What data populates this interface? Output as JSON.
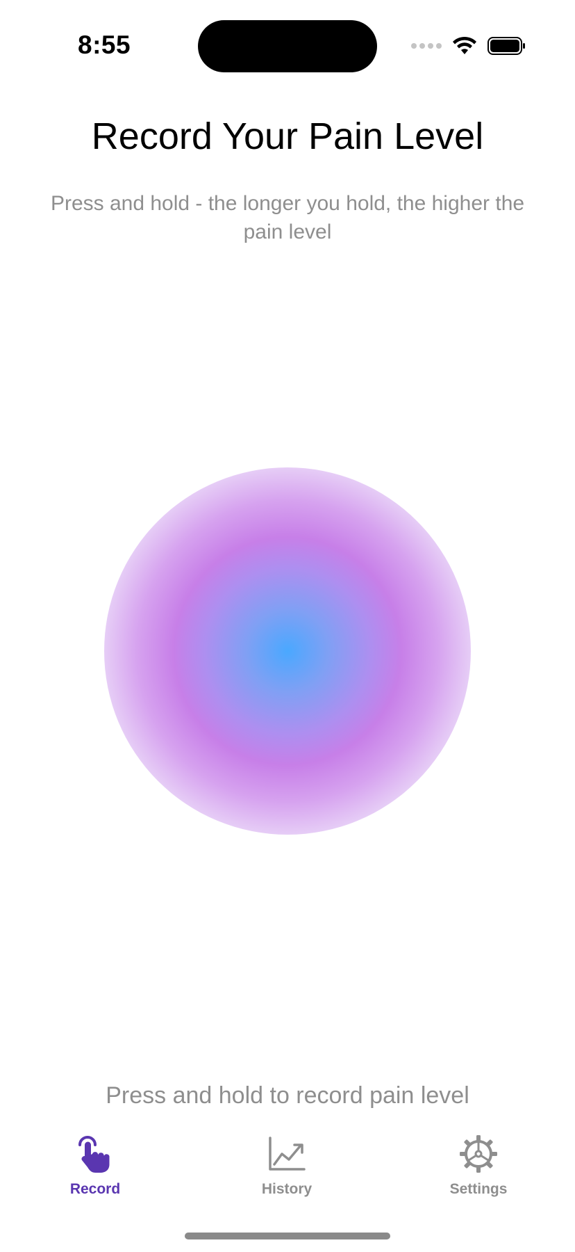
{
  "status_bar": {
    "time": "8:55"
  },
  "header": {
    "title": "Record Your Pain Level",
    "subtitle": "Press and hold - the longer you hold, the higher the pain level"
  },
  "hint": "Press and hold to record pain level",
  "colors": {
    "accent": "#5a36b0",
    "inactive": "#8e8e8e",
    "circle_center": "#4aa8ff",
    "circle_mid": "#c77fe8",
    "circle_edge": "#e6cdf6"
  },
  "tabs": [
    {
      "label": "Record",
      "icon": "hand-tap-icon",
      "active": true
    },
    {
      "label": "History",
      "icon": "chart-line-icon",
      "active": false
    },
    {
      "label": "Settings",
      "icon": "gear-icon",
      "active": false
    }
  ]
}
